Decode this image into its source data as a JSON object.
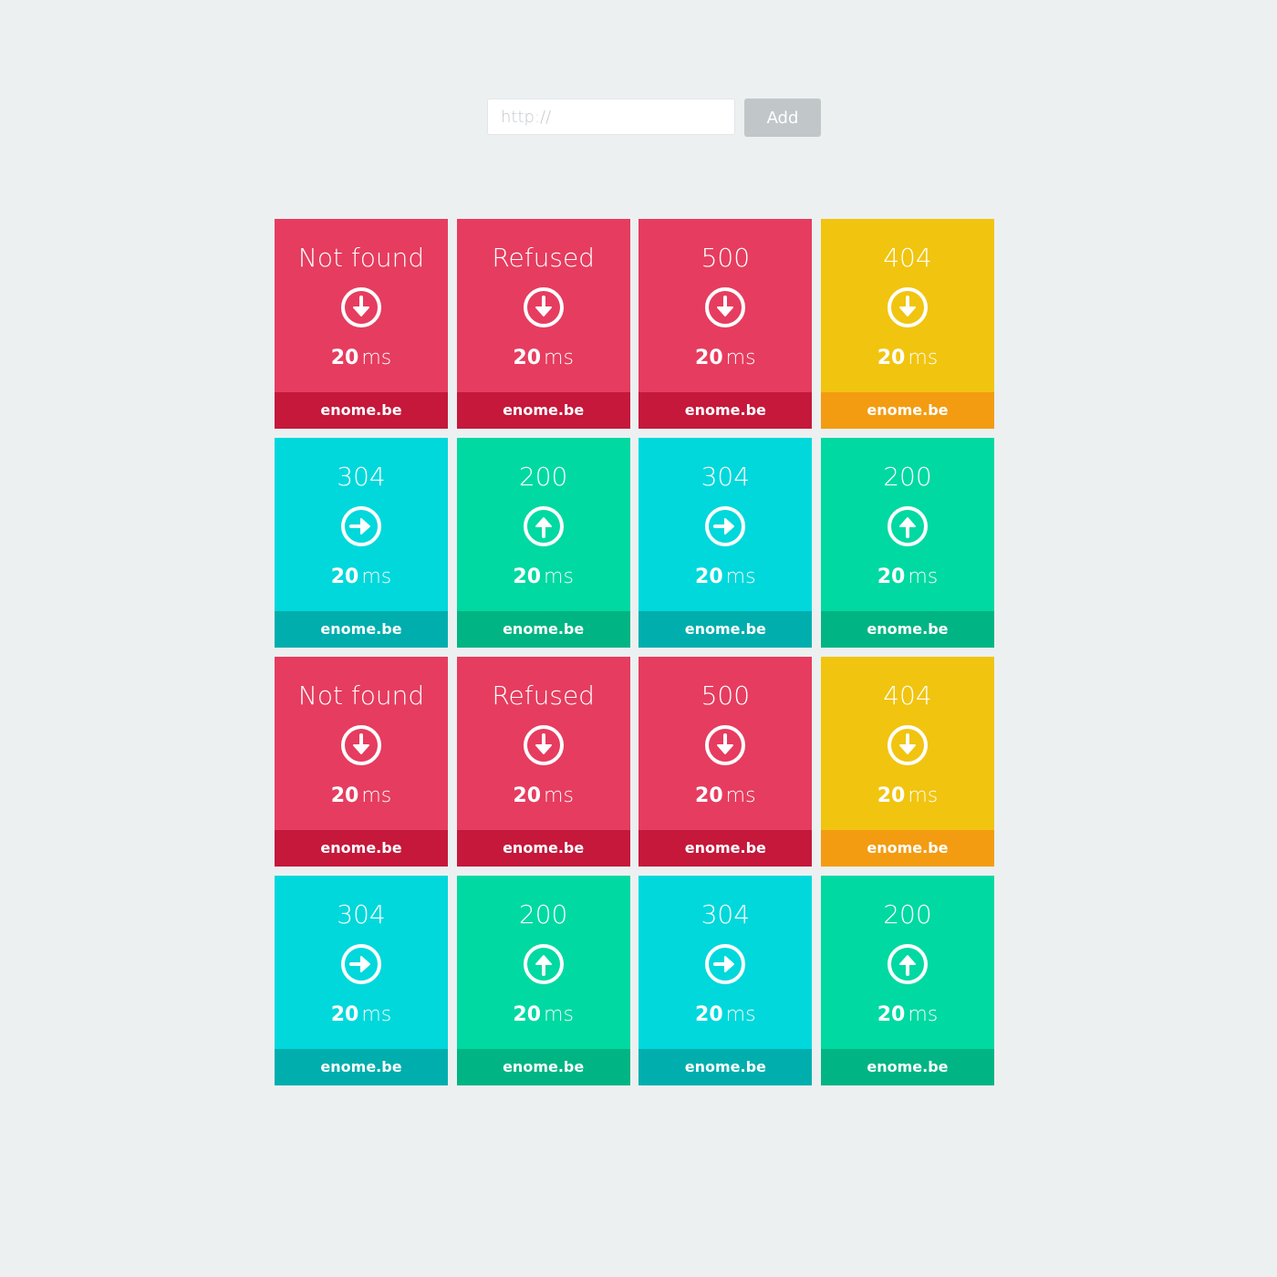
{
  "add_form": {
    "url_placeholder": "http://",
    "url_value": "",
    "add_label": "Add"
  },
  "colors": {
    "page_background": "#ecf0f1",
    "input_background": "#ffffff",
    "button_background": "#c1c6c9",
    "text": "#ffffff",
    "red_main": "#e63c5f",
    "red_footer": "#c5183b",
    "yellow_main": "#f1c40f",
    "yellow_footer": "#f39c12",
    "cyan_main": "#00d8dc",
    "cyan_footer": "#00aeae",
    "green_main": "#00d9a2",
    "green_footer": "#00b583"
  },
  "tiles": [
    {
      "status": "Not found",
      "time": "20",
      "unit": "ms",
      "site": "enome.be",
      "color": "red",
      "icon": "arrow-down-circle-icon"
    },
    {
      "status": "Refused",
      "time": "20",
      "unit": "ms",
      "site": "enome.be",
      "color": "red",
      "icon": "arrow-down-circle-icon"
    },
    {
      "status": "500",
      "time": "20",
      "unit": "ms",
      "site": "enome.be",
      "color": "red",
      "icon": "arrow-down-circle-icon"
    },
    {
      "status": "404",
      "time": "20",
      "unit": "ms",
      "site": "enome.be",
      "color": "yellow",
      "icon": "arrow-down-circle-icon"
    },
    {
      "status": "304",
      "time": "20",
      "unit": "ms",
      "site": "enome.be",
      "color": "cyan",
      "icon": "arrow-right-circle-icon"
    },
    {
      "status": "200",
      "time": "20",
      "unit": "ms",
      "site": "enome.be",
      "color": "green",
      "icon": "arrow-up-circle-icon"
    },
    {
      "status": "304",
      "time": "20",
      "unit": "ms",
      "site": "enome.be",
      "color": "cyan",
      "icon": "arrow-right-circle-icon"
    },
    {
      "status": "200",
      "time": "20",
      "unit": "ms",
      "site": "enome.be",
      "color": "green",
      "icon": "arrow-up-circle-icon"
    },
    {
      "status": "Not found",
      "time": "20",
      "unit": "ms",
      "site": "enome.be",
      "color": "red",
      "icon": "arrow-down-circle-icon"
    },
    {
      "status": "Refused",
      "time": "20",
      "unit": "ms",
      "site": "enome.be",
      "color": "red",
      "icon": "arrow-down-circle-icon"
    },
    {
      "status": "500",
      "time": "20",
      "unit": "ms",
      "site": "enome.be",
      "color": "red",
      "icon": "arrow-down-circle-icon"
    },
    {
      "status": "404",
      "time": "20",
      "unit": "ms",
      "site": "enome.be",
      "color": "yellow",
      "icon": "arrow-down-circle-icon"
    },
    {
      "status": "304",
      "time": "20",
      "unit": "ms",
      "site": "enome.be",
      "color": "cyan",
      "icon": "arrow-right-circle-icon"
    },
    {
      "status": "200",
      "time": "20",
      "unit": "ms",
      "site": "enome.be",
      "color": "green",
      "icon": "arrow-up-circle-icon"
    },
    {
      "status": "304",
      "time": "20",
      "unit": "ms",
      "site": "enome.be",
      "color": "cyan",
      "icon": "arrow-right-circle-icon"
    },
    {
      "status": "200",
      "time": "20",
      "unit": "ms",
      "site": "enome.be",
      "color": "green",
      "icon": "arrow-up-circle-icon"
    }
  ]
}
